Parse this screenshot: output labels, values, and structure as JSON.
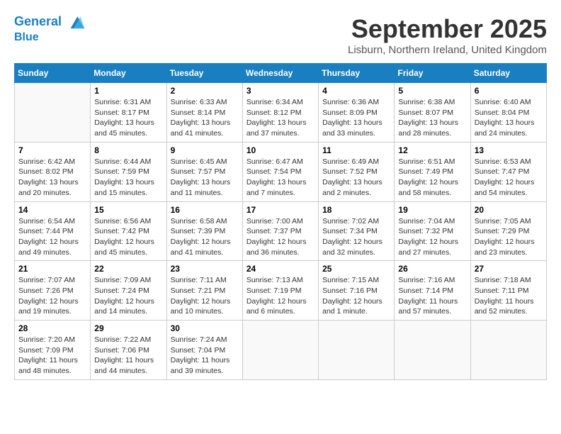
{
  "header": {
    "logo_line1": "General",
    "logo_line2": "Blue",
    "month_title": "September 2025",
    "location": "Lisburn, Northern Ireland, United Kingdom"
  },
  "weekdays": [
    "Sunday",
    "Monday",
    "Tuesday",
    "Wednesday",
    "Thursday",
    "Friday",
    "Saturday"
  ],
  "weeks": [
    [
      {
        "day": "",
        "info": ""
      },
      {
        "day": "1",
        "info": "Sunrise: 6:31 AM\nSunset: 8:17 PM\nDaylight: 13 hours\nand 45 minutes."
      },
      {
        "day": "2",
        "info": "Sunrise: 6:33 AM\nSunset: 8:14 PM\nDaylight: 13 hours\nand 41 minutes."
      },
      {
        "day": "3",
        "info": "Sunrise: 6:34 AM\nSunset: 8:12 PM\nDaylight: 13 hours\nand 37 minutes."
      },
      {
        "day": "4",
        "info": "Sunrise: 6:36 AM\nSunset: 8:09 PM\nDaylight: 13 hours\nand 33 minutes."
      },
      {
        "day": "5",
        "info": "Sunrise: 6:38 AM\nSunset: 8:07 PM\nDaylight: 13 hours\nand 28 minutes."
      },
      {
        "day": "6",
        "info": "Sunrise: 6:40 AM\nSunset: 8:04 PM\nDaylight: 13 hours\nand 24 minutes."
      }
    ],
    [
      {
        "day": "7",
        "info": "Sunrise: 6:42 AM\nSunset: 8:02 PM\nDaylight: 13 hours\nand 20 minutes."
      },
      {
        "day": "8",
        "info": "Sunrise: 6:44 AM\nSunset: 7:59 PM\nDaylight: 13 hours\nand 15 minutes."
      },
      {
        "day": "9",
        "info": "Sunrise: 6:45 AM\nSunset: 7:57 PM\nDaylight: 13 hours\nand 11 minutes."
      },
      {
        "day": "10",
        "info": "Sunrise: 6:47 AM\nSunset: 7:54 PM\nDaylight: 13 hours\nand 7 minutes."
      },
      {
        "day": "11",
        "info": "Sunrise: 6:49 AM\nSunset: 7:52 PM\nDaylight: 13 hours\nand 2 minutes."
      },
      {
        "day": "12",
        "info": "Sunrise: 6:51 AM\nSunset: 7:49 PM\nDaylight: 12 hours\nand 58 minutes."
      },
      {
        "day": "13",
        "info": "Sunrise: 6:53 AM\nSunset: 7:47 PM\nDaylight: 12 hours\nand 54 minutes."
      }
    ],
    [
      {
        "day": "14",
        "info": "Sunrise: 6:54 AM\nSunset: 7:44 PM\nDaylight: 12 hours\nand 49 minutes."
      },
      {
        "day": "15",
        "info": "Sunrise: 6:56 AM\nSunset: 7:42 PM\nDaylight: 12 hours\nand 45 minutes."
      },
      {
        "day": "16",
        "info": "Sunrise: 6:58 AM\nSunset: 7:39 PM\nDaylight: 12 hours\nand 41 minutes."
      },
      {
        "day": "17",
        "info": "Sunrise: 7:00 AM\nSunset: 7:37 PM\nDaylight: 12 hours\nand 36 minutes."
      },
      {
        "day": "18",
        "info": "Sunrise: 7:02 AM\nSunset: 7:34 PM\nDaylight: 12 hours\nand 32 minutes."
      },
      {
        "day": "19",
        "info": "Sunrise: 7:04 AM\nSunset: 7:32 PM\nDaylight: 12 hours\nand 27 minutes."
      },
      {
        "day": "20",
        "info": "Sunrise: 7:05 AM\nSunset: 7:29 PM\nDaylight: 12 hours\nand 23 minutes."
      }
    ],
    [
      {
        "day": "21",
        "info": "Sunrise: 7:07 AM\nSunset: 7:26 PM\nDaylight: 12 hours\nand 19 minutes."
      },
      {
        "day": "22",
        "info": "Sunrise: 7:09 AM\nSunset: 7:24 PM\nDaylight: 12 hours\nand 14 minutes."
      },
      {
        "day": "23",
        "info": "Sunrise: 7:11 AM\nSunset: 7:21 PM\nDaylight: 12 hours\nand 10 minutes."
      },
      {
        "day": "24",
        "info": "Sunrise: 7:13 AM\nSunset: 7:19 PM\nDaylight: 12 hours\nand 6 minutes."
      },
      {
        "day": "25",
        "info": "Sunrise: 7:15 AM\nSunset: 7:16 PM\nDaylight: 12 hours\nand 1 minute."
      },
      {
        "day": "26",
        "info": "Sunrise: 7:16 AM\nSunset: 7:14 PM\nDaylight: 11 hours\nand 57 minutes."
      },
      {
        "day": "27",
        "info": "Sunrise: 7:18 AM\nSunset: 7:11 PM\nDaylight: 11 hours\nand 52 minutes."
      }
    ],
    [
      {
        "day": "28",
        "info": "Sunrise: 7:20 AM\nSunset: 7:09 PM\nDaylight: 11 hours\nand 48 minutes."
      },
      {
        "day": "29",
        "info": "Sunrise: 7:22 AM\nSunset: 7:06 PM\nDaylight: 11 hours\nand 44 minutes."
      },
      {
        "day": "30",
        "info": "Sunrise: 7:24 AM\nSunset: 7:04 PM\nDaylight: 11 hours\nand 39 minutes."
      },
      {
        "day": "",
        "info": ""
      },
      {
        "day": "",
        "info": ""
      },
      {
        "day": "",
        "info": ""
      },
      {
        "day": "",
        "info": ""
      }
    ]
  ]
}
